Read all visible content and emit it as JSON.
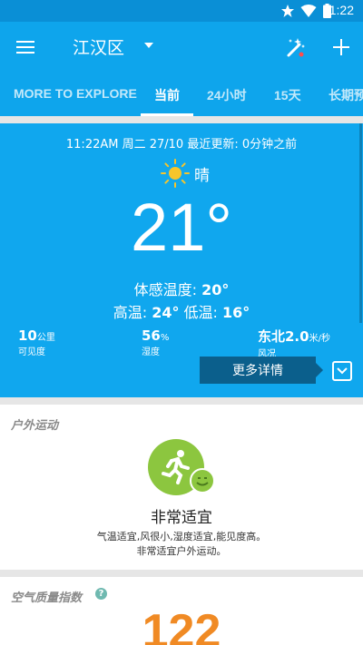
{
  "status_bar": {
    "time": "11:22",
    "icons": [
      "star-icon",
      "wifi-icon",
      "battery-icon"
    ]
  },
  "app_bar": {
    "location": "江汉区",
    "icons": [
      "menu-icon",
      "dropdown-icon",
      "magic-wand-icon",
      "add-icon"
    ]
  },
  "tabs": [
    {
      "label": "MORE TO EXPLORE",
      "active": false
    },
    {
      "label": "当前",
      "active": true
    },
    {
      "label": "24小时",
      "active": false
    },
    {
      "label": "15天",
      "active": false
    },
    {
      "label": "长期预",
      "active": false
    }
  ],
  "current": {
    "updated_text": "11:22AM 周二 27/10 最近更新: 0分钟之前",
    "condition": "晴",
    "condition_icon": "sun-icon",
    "temperature": "21°",
    "feels_like_label": "体感温度: ",
    "feels_like_value": "20°",
    "high_label": "高温: ",
    "high_value": "24°",
    "low_label": " 低温: ",
    "low_value": "16°",
    "visibility": {
      "value": "10",
      "unit": "公里",
      "label": "可见度"
    },
    "humidity": {
      "value": "56",
      "unit": "%",
      "label": "湿度"
    },
    "wind": {
      "value": "东北2.0",
      "unit": "米/秒",
      "label": "风况"
    },
    "more_details": "更多详情"
  },
  "outdoor": {
    "title": "户外运动",
    "rating": "非常适宜",
    "desc_line1": "气温适宜,风很小,湿度适宜,能见度高。",
    "desc_line2": "非常适宜户外运动。"
  },
  "aqi": {
    "title": "空气质量指数",
    "help": "?",
    "value": "122"
  },
  "colors": {
    "primary": "#0ea5ec",
    "status": "#0a8fd6",
    "green": "#8cc63f",
    "aqi": "#f08a24"
  }
}
